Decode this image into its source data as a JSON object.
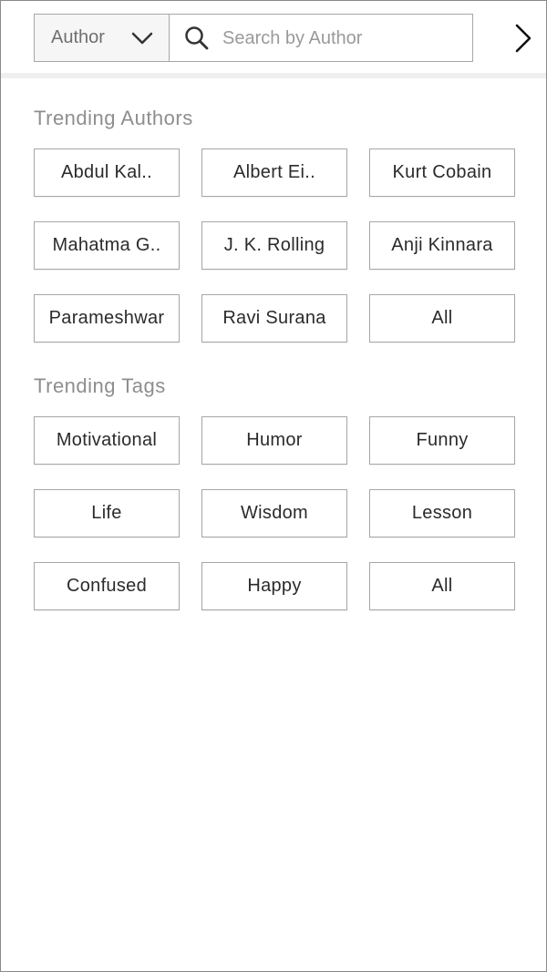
{
  "search": {
    "filter_label": "Author",
    "placeholder": "Search by Author",
    "value": ""
  },
  "trending_authors": {
    "title": "Trending Authors",
    "items": [
      "Abdul Kal..",
      "Albert Ei..",
      "Kurt Cobain",
      "Mahatma G..",
      "J. K. Rolling",
      "Anji Kinnara",
      "Parameshwar",
      "Ravi Surana",
      "All"
    ]
  },
  "trending_tags": {
    "title": "Trending Tags",
    "items": [
      "Motivational",
      "Humor",
      "Funny",
      "Life",
      "Wisdom",
      "Lesson",
      "Confused",
      "Happy",
      "All"
    ]
  },
  "icons": {
    "filter_dropdown": "chevron-down-icon",
    "search": "search-icon",
    "next": "chevron-right-icon"
  }
}
